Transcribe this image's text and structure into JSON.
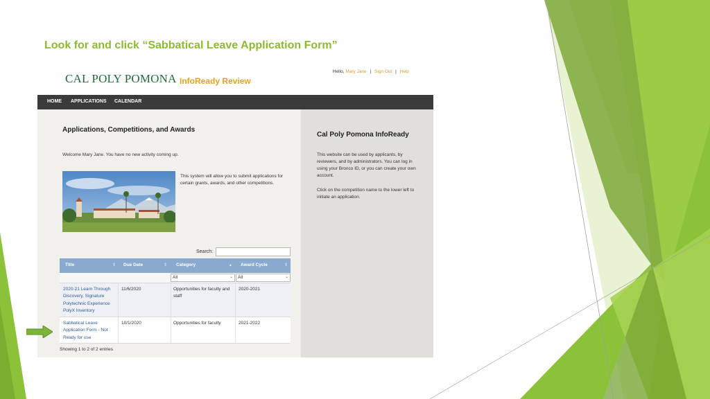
{
  "slide": {
    "title": "Look for and click “Sabbatical Leave Application Form”",
    "accent_color": "#8dbb2e"
  },
  "header": {
    "logo_text": "CAL POLY POMONA",
    "logo_subtitle": "InfoReady Review",
    "hello": "Hello,",
    "user_name": "Mary Jane",
    "sign_out": "Sign Out",
    "help": "Help",
    "separator": "|"
  },
  "nav": {
    "items": [
      {
        "label": "HOME"
      },
      {
        "label": "APPLICATIONS"
      },
      {
        "label": "CALENDAR"
      }
    ]
  },
  "main": {
    "heading": "Applications, Competitions, and Awards",
    "welcome": "Welcome Mary Jane. You have no new activity coming up.",
    "intro": "This system will allow you to submit applications for certain grants, awards, and other competitions.",
    "search_label": "Search:",
    "search_value": "",
    "table": {
      "columns": [
        {
          "label": "Title"
        },
        {
          "label": "Due Date"
        },
        {
          "label": "Category"
        },
        {
          "label": "Award Cycle"
        }
      ],
      "filters": {
        "category": "All",
        "award_cycle": "All"
      },
      "rows": [
        {
          "title": "2020-21 Learn Through Discovery, Signature Polytechnic Experience PolyX Inventory",
          "due_date": "11/6/2020",
          "category": "Opportunities for faculty and staff",
          "award_cycle": "2020-2021"
        },
        {
          "title": "Sabbatical Leave Application Form - Not Ready for use",
          "due_date": "10/1/2020",
          "category": "Opportunities for faculty",
          "award_cycle": "2021-2022"
        }
      ]
    },
    "footer": "Showing 1 to 2 of 2 entries"
  },
  "sidebar": {
    "heading": "Cal Poly Pomona InfoReady",
    "para1": "This website can be used by applicants, by reviewers, and by administrators. You can log in using your Bronco ID, or you can create your own account.",
    "para2": "Click on the competition name to the lower left to initiate an application."
  },
  "icons": {
    "arrow": "right-arrow-icon",
    "sort": "sort-icon",
    "dropdown": "chevron-down-icon"
  }
}
